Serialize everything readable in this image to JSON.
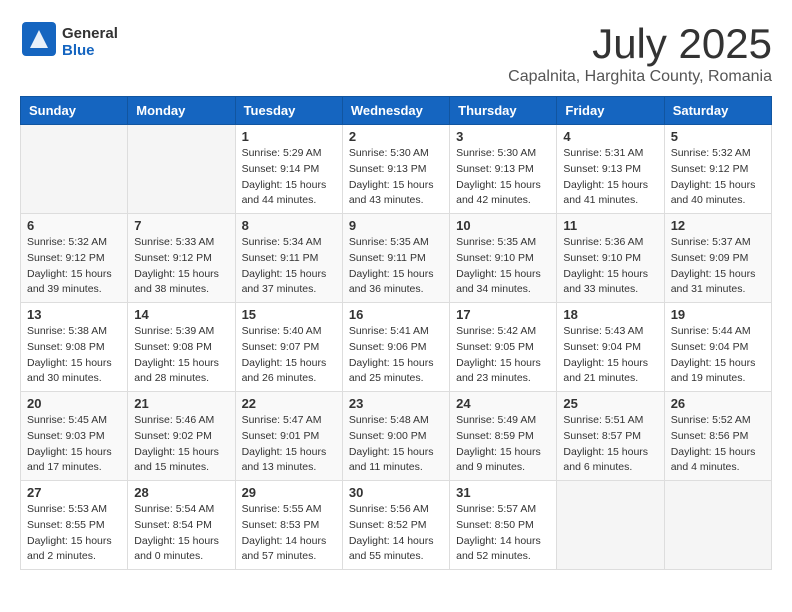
{
  "logo": {
    "general": "General",
    "blue": "Blue"
  },
  "title": "July 2025",
  "subtitle": "Capalnita, Harghita County, Romania",
  "weekdays": [
    "Sunday",
    "Monday",
    "Tuesday",
    "Wednesday",
    "Thursday",
    "Friday",
    "Saturday"
  ],
  "weeks": [
    [
      {
        "day": "",
        "info": ""
      },
      {
        "day": "",
        "info": ""
      },
      {
        "day": "1",
        "info": "Sunrise: 5:29 AM\nSunset: 9:14 PM\nDaylight: 15 hours and 44 minutes."
      },
      {
        "day": "2",
        "info": "Sunrise: 5:30 AM\nSunset: 9:13 PM\nDaylight: 15 hours and 43 minutes."
      },
      {
        "day": "3",
        "info": "Sunrise: 5:30 AM\nSunset: 9:13 PM\nDaylight: 15 hours and 42 minutes."
      },
      {
        "day": "4",
        "info": "Sunrise: 5:31 AM\nSunset: 9:13 PM\nDaylight: 15 hours and 41 minutes."
      },
      {
        "day": "5",
        "info": "Sunrise: 5:32 AM\nSunset: 9:12 PM\nDaylight: 15 hours and 40 minutes."
      }
    ],
    [
      {
        "day": "6",
        "info": "Sunrise: 5:32 AM\nSunset: 9:12 PM\nDaylight: 15 hours and 39 minutes."
      },
      {
        "day": "7",
        "info": "Sunrise: 5:33 AM\nSunset: 9:12 PM\nDaylight: 15 hours and 38 minutes."
      },
      {
        "day": "8",
        "info": "Sunrise: 5:34 AM\nSunset: 9:11 PM\nDaylight: 15 hours and 37 minutes."
      },
      {
        "day": "9",
        "info": "Sunrise: 5:35 AM\nSunset: 9:11 PM\nDaylight: 15 hours and 36 minutes."
      },
      {
        "day": "10",
        "info": "Sunrise: 5:35 AM\nSunset: 9:10 PM\nDaylight: 15 hours and 34 minutes."
      },
      {
        "day": "11",
        "info": "Sunrise: 5:36 AM\nSunset: 9:10 PM\nDaylight: 15 hours and 33 minutes."
      },
      {
        "day": "12",
        "info": "Sunrise: 5:37 AM\nSunset: 9:09 PM\nDaylight: 15 hours and 31 minutes."
      }
    ],
    [
      {
        "day": "13",
        "info": "Sunrise: 5:38 AM\nSunset: 9:08 PM\nDaylight: 15 hours and 30 minutes."
      },
      {
        "day": "14",
        "info": "Sunrise: 5:39 AM\nSunset: 9:08 PM\nDaylight: 15 hours and 28 minutes."
      },
      {
        "day": "15",
        "info": "Sunrise: 5:40 AM\nSunset: 9:07 PM\nDaylight: 15 hours and 26 minutes."
      },
      {
        "day": "16",
        "info": "Sunrise: 5:41 AM\nSunset: 9:06 PM\nDaylight: 15 hours and 25 minutes."
      },
      {
        "day": "17",
        "info": "Sunrise: 5:42 AM\nSunset: 9:05 PM\nDaylight: 15 hours and 23 minutes."
      },
      {
        "day": "18",
        "info": "Sunrise: 5:43 AM\nSunset: 9:04 PM\nDaylight: 15 hours and 21 minutes."
      },
      {
        "day": "19",
        "info": "Sunrise: 5:44 AM\nSunset: 9:04 PM\nDaylight: 15 hours and 19 minutes."
      }
    ],
    [
      {
        "day": "20",
        "info": "Sunrise: 5:45 AM\nSunset: 9:03 PM\nDaylight: 15 hours and 17 minutes."
      },
      {
        "day": "21",
        "info": "Sunrise: 5:46 AM\nSunset: 9:02 PM\nDaylight: 15 hours and 15 minutes."
      },
      {
        "day": "22",
        "info": "Sunrise: 5:47 AM\nSunset: 9:01 PM\nDaylight: 15 hours and 13 minutes."
      },
      {
        "day": "23",
        "info": "Sunrise: 5:48 AM\nSunset: 9:00 PM\nDaylight: 15 hours and 11 minutes."
      },
      {
        "day": "24",
        "info": "Sunrise: 5:49 AM\nSunset: 8:59 PM\nDaylight: 15 hours and 9 minutes."
      },
      {
        "day": "25",
        "info": "Sunrise: 5:51 AM\nSunset: 8:57 PM\nDaylight: 15 hours and 6 minutes."
      },
      {
        "day": "26",
        "info": "Sunrise: 5:52 AM\nSunset: 8:56 PM\nDaylight: 15 hours and 4 minutes."
      }
    ],
    [
      {
        "day": "27",
        "info": "Sunrise: 5:53 AM\nSunset: 8:55 PM\nDaylight: 15 hours and 2 minutes."
      },
      {
        "day": "28",
        "info": "Sunrise: 5:54 AM\nSunset: 8:54 PM\nDaylight: 15 hours and 0 minutes."
      },
      {
        "day": "29",
        "info": "Sunrise: 5:55 AM\nSunset: 8:53 PM\nDaylight: 14 hours and 57 minutes."
      },
      {
        "day": "30",
        "info": "Sunrise: 5:56 AM\nSunset: 8:52 PM\nDaylight: 14 hours and 55 minutes."
      },
      {
        "day": "31",
        "info": "Sunrise: 5:57 AM\nSunset: 8:50 PM\nDaylight: 14 hours and 52 minutes."
      },
      {
        "day": "",
        "info": ""
      },
      {
        "day": "",
        "info": ""
      }
    ]
  ]
}
